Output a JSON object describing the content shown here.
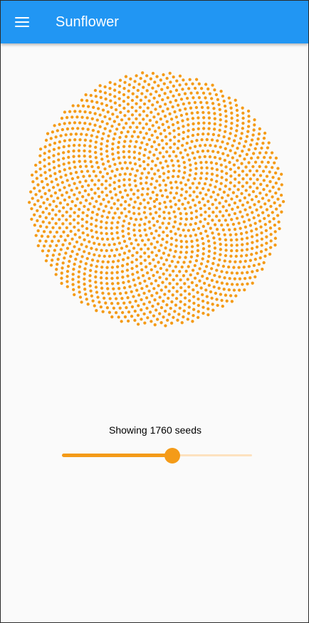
{
  "app_bar": {
    "title": "Sunflower",
    "menu_icon": "menu-icon",
    "color": "#2196f3"
  },
  "sunflower": {
    "seed_color": "#f49b18",
    "seed_count": 1760
  },
  "controls": {
    "status_text": "Showing 1760 seeds",
    "slider": {
      "value_fraction": 0.58,
      "active_color": "#f49b18",
      "inactive_color": "#fde2bf"
    }
  }
}
